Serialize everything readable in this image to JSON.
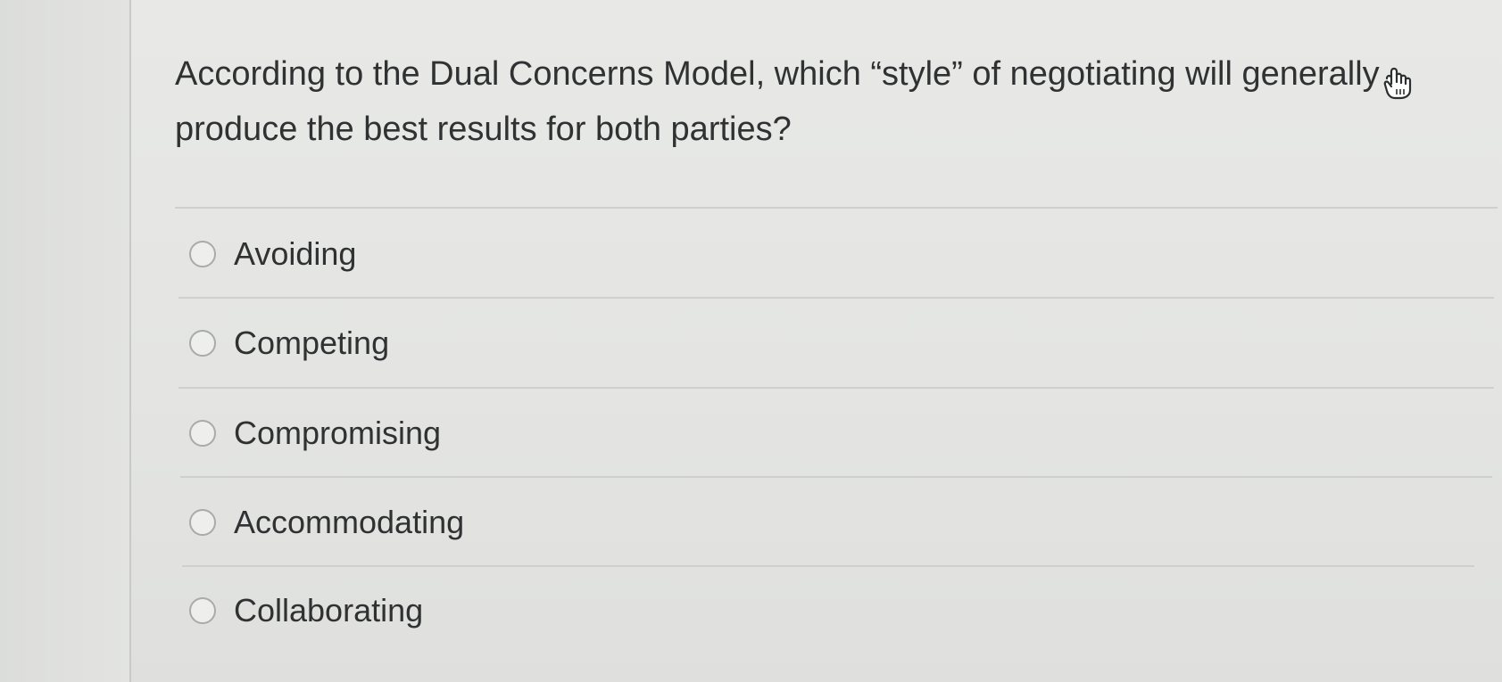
{
  "question": {
    "text": "According to the Dual Concerns Model, which “style” of negotiating will generally produce the best results for both parties?"
  },
  "options": [
    {
      "label": "Avoiding"
    },
    {
      "label": "Competing"
    },
    {
      "label": "Compromising"
    },
    {
      "label": "Accommodating"
    },
    {
      "label": "Collaborating"
    }
  ],
  "cursor": {
    "icon": "hand-pointer-icon"
  }
}
